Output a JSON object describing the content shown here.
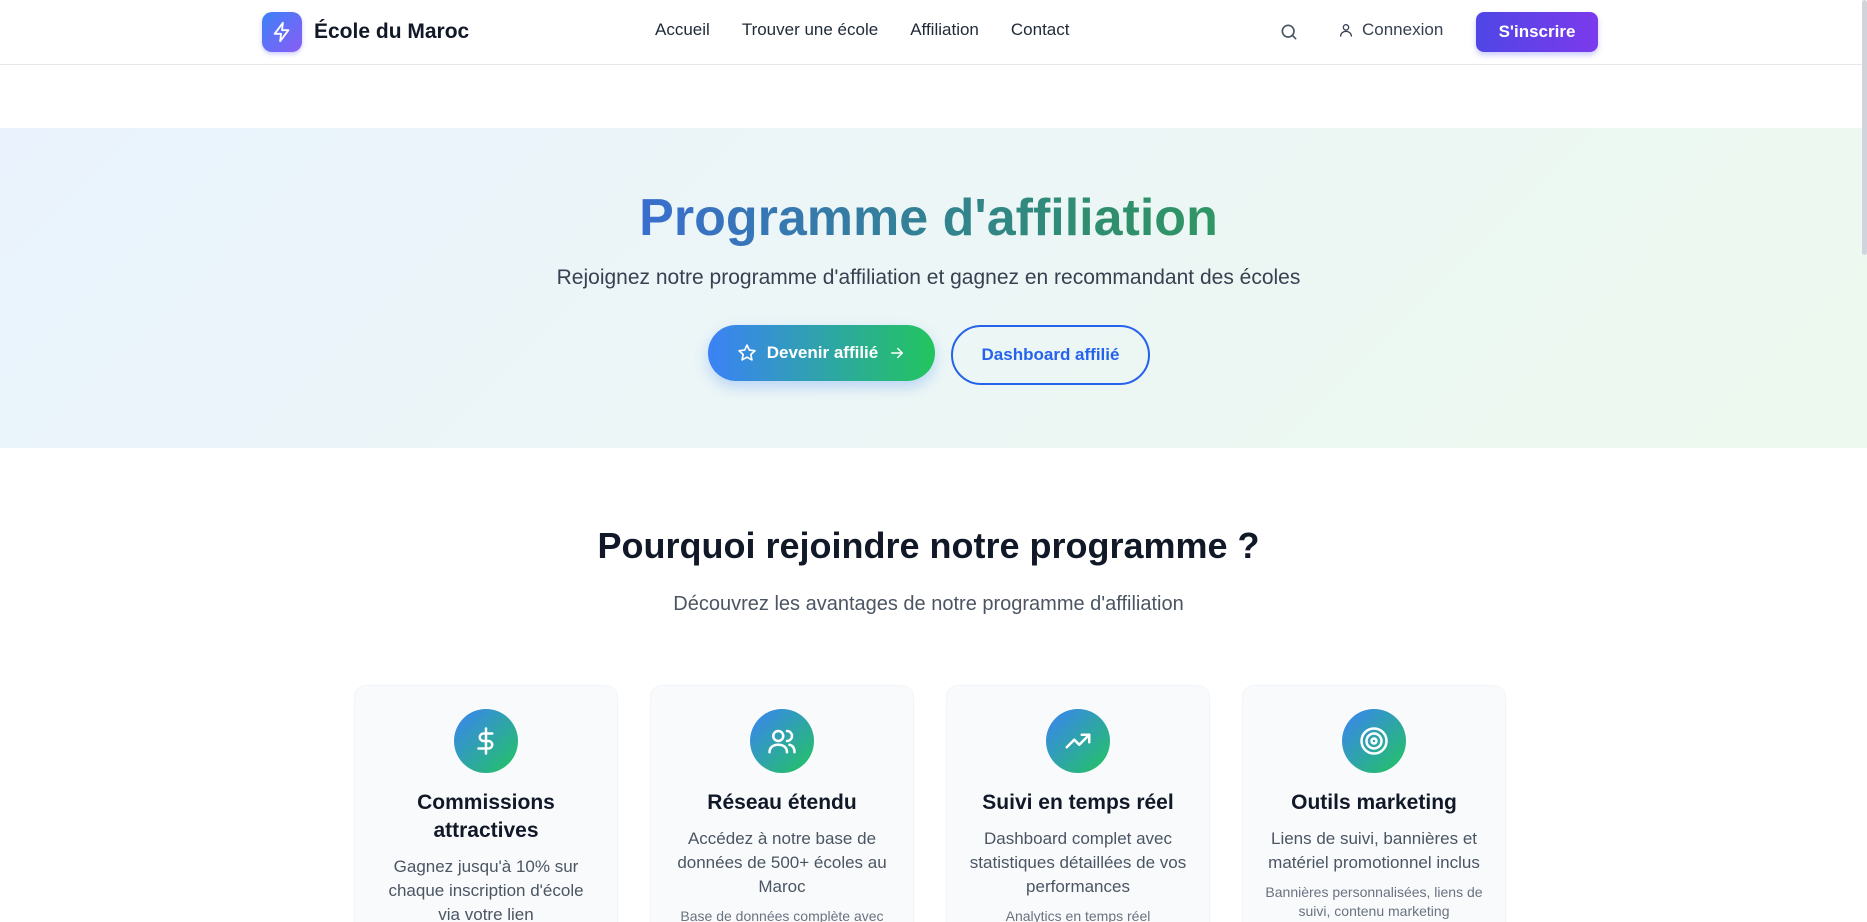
{
  "header": {
    "logo_text": "École du Maroc",
    "nav": [
      "Accueil",
      "Trouver une école",
      "Affiliation",
      "Contact"
    ],
    "login_label": "Connexion",
    "signup_label": "S'inscrire"
  },
  "hero": {
    "title": "Programme d'affiliation",
    "subtitle": "Rejoignez notre programme d'affiliation et gagnez en recommandant des écoles",
    "primary_button": "Devenir affilié",
    "secondary_button": "Dashboard affilié"
  },
  "why": {
    "title": "Pourquoi rejoindre notre programme ?",
    "subtitle": "Découvrez les avantages de notre programme d'affiliation",
    "cards": [
      {
        "icon": "dollar-icon",
        "title": "Commissions attractives",
        "desc": "Gagnez jusqu'à 10% sur chaque inscription d'école via votre lien",
        "note": ""
      },
      {
        "icon": "users-icon",
        "title": "Réseau étendu",
        "desc": "Accédez à notre base de données de 500+ écoles au Maroc",
        "note": "Base de données complète avec"
      },
      {
        "icon": "trending-up-icon",
        "title": "Suivi en temps réel",
        "desc": "Dashboard complet avec statistiques détaillées de vos performances",
        "note": "Analytics en temps réel"
      },
      {
        "icon": "target-icon",
        "title": "Outils marketing",
        "desc": "Liens de suivi, bannières et matériel promotionnel inclus",
        "note": "Bannières personnalisées, liens de suivi, contenu marketing"
      }
    ]
  },
  "colors": {
    "accent_blue": "#3b82f6",
    "accent_green": "#22c55e",
    "signup_purple": "#7c3aed"
  }
}
